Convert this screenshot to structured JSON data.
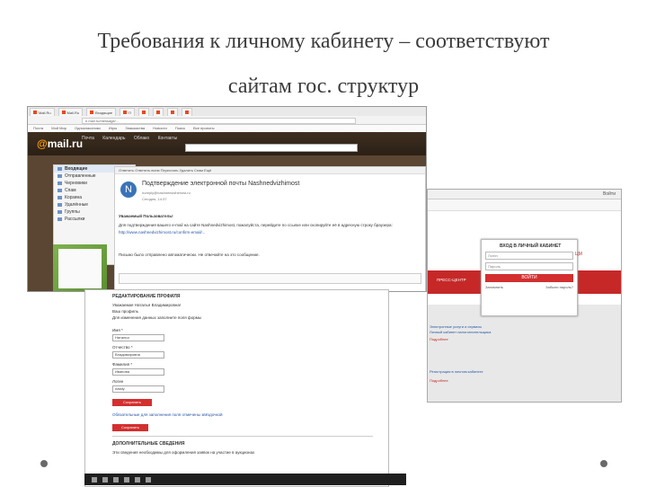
{
  "slide": {
    "title_line1": "Требования к личному кабинету – соответствуют",
    "title_line2": "сайтам гос. структур"
  },
  "mail": {
    "tabs": [
      "Mail.Ru",
      "Mail.Ru",
      "Входящие",
      "П",
      "",
      "",
      "",
      ""
    ],
    "address": "e.mail.ru/message/...",
    "bookmarks": [
      "Почта",
      "Мой Мир",
      "Одноклассники",
      "Игры",
      "Знакомства",
      "Новости",
      "Поиск",
      "Все проекты"
    ],
    "logo_prefix": "@",
    "logo_text": "mail.ru",
    "nav": [
      "Почта",
      "Календарь",
      "Облако",
      "Контакты"
    ],
    "folders": [
      "Входящие",
      "Отправленные",
      "Черновики",
      "Спам",
      "Корзина",
      "Удалённые",
      "Группы",
      "Рассылки"
    ],
    "toolbar_text": "Ответить   Ответить всем   Переслать   Удалить   Спам   Ещё",
    "avatar_letter": "N",
    "subject": "Подтверждение электронной почты Nashnedvizhimost",
    "sender": "noreply@nashnedvizhimost.ru",
    "date": "Сегодня, 14:37",
    "greeting": "Уважаемый Пользователь!",
    "body_line": "Для подтверждения вашего e-mail на сайте Nashnedvizhimost, пожалуйста, перейдите по ссылке или скопируйте её в адресную строку браузера:",
    "link": "http://www.nashnedvizhimost.ru/confirm-email/...",
    "footer_text": "Письмо было отправлено автоматически. Не отвечайте на это сообщение."
  },
  "login": {
    "bar_text": "Войти",
    "title": "ВХОД В ЛИЧНЫЙ КАБИНЕТ",
    "login_placeholder": "Логин",
    "password_placeholder": "Пароль",
    "submit": "ВОЙТИ",
    "remember": "Запомнить",
    "forgot": "Забыли пароль?",
    "esia": "ЦМ",
    "red_button": "ПРЕСС-ЦЕНТР",
    "links": [
      "Электронные услуги и сервисы",
      "Личный кабинет налогоплательщика",
      "Подробнее",
      "Регистрация в личном кабинете",
      "Подробнее"
    ]
  },
  "form": {
    "header": "РЕДАКТИРОВАНИЕ ПРОФИЛЯ",
    "greeting": "Уважаемая Наталья Владимировна!",
    "line1": "Ваш профиль",
    "line2": "Для изменения данных заполните поля формы",
    "label_first": "Имя *",
    "value_first": "Наталья",
    "label_middle": "Отчество *",
    "value_middle": "Владимировна",
    "label_last": "Фамилия *",
    "value_last": "Иванова",
    "label_login": "Логин",
    "value_login": "nataly",
    "save": "Сохранить",
    "hint": "Обязательные для заполнения поля отмечены звёздочкой",
    "save2": "Сохранить",
    "section2": "ДОПОЛНИТЕЛЬНЫЕ СВЕДЕНИЯ",
    "section2_text": "Эти сведения необходимы для оформления заявок на участие в аукционах"
  },
  "colors": {
    "accent_red": "#d32f2f",
    "mail_orange": "#ff9e00"
  }
}
